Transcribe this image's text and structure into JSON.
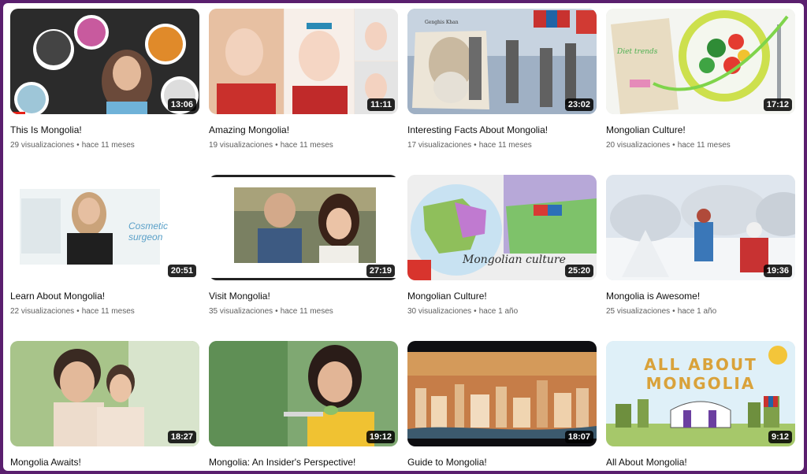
{
  "videos": [
    {
      "title": "This Is Mongolia!",
      "views": "29 visualizaciones",
      "age": "hace 11 meses",
      "duration": "13:06",
      "watched": 0.08
    },
    {
      "title": "Amazing Mongolia!",
      "views": "19 visualizaciones",
      "age": "hace 11 meses",
      "duration": "11:11"
    },
    {
      "title": "Interesting Facts About Mongolia!",
      "views": "17 visualizaciones",
      "age": "hace 11 meses",
      "duration": "23:02",
      "overlay": "Genghis Khan"
    },
    {
      "title": "Mongolian Culture!",
      "views": "20 visualizaciones",
      "age": "hace 11 meses",
      "duration": "17:12",
      "overlay": "Diet trends"
    },
    {
      "title": "Learn About Mongolia!",
      "views": "22 visualizaciones",
      "age": "hace 11 meses",
      "duration": "20:51",
      "overlay": "Cosmetic surgeon"
    },
    {
      "title": "Visit Mongolia!",
      "views": "35 visualizaciones",
      "age": "hace 11 meses",
      "duration": "27:19"
    },
    {
      "title": "Mongolian Culture!",
      "views": "30 visualizaciones",
      "age": "hace 1 año",
      "duration": "25:20",
      "overlay": "Mongolian culture"
    },
    {
      "title": "Mongolia is Awesome!",
      "views": "25 visualizaciones",
      "age": "hace 1 año",
      "duration": "19:36"
    },
    {
      "title": "Mongolia Awaits!",
      "views": "",
      "age": "",
      "duration": "18:27"
    },
    {
      "title": "Mongolia: An Insider's Perspective!",
      "views": "",
      "age": "",
      "duration": "19:12"
    },
    {
      "title": "Guide to Mongolia!",
      "views": "",
      "age": "",
      "duration": "18:07"
    },
    {
      "title": "All About Mongolia!",
      "views": "",
      "age": "",
      "duration": "9:12",
      "overlay": "ALL ABOUT MONGOLIA"
    }
  ],
  "colors": {
    "frame": "#5a1f6e",
    "progress": "#e62117"
  }
}
